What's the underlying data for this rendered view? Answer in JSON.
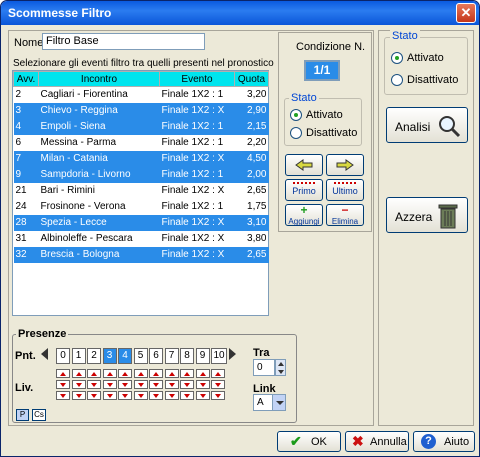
{
  "window": {
    "title": "Scommesse Filtro",
    "close_glyph": "✕"
  },
  "name_label": "Nome",
  "name_value": "Filtro Base",
  "instruction": "Selezionare gli eventi filtro tra quelli presenti nel pronostico",
  "table": {
    "headers": [
      "Avv.",
      "Incontro",
      "Evento",
      "Quota"
    ],
    "rows": [
      {
        "avv": "2",
        "incontro": "Cagliari - Fiorentina",
        "evento": "Finale 1X2 : 1",
        "quota": "3,20",
        "selected": false
      },
      {
        "avv": "3",
        "incontro": "Chievo - Reggina",
        "evento": "Finale 1X2 : X",
        "quota": "2,90",
        "selected": true
      },
      {
        "avv": "4",
        "incontro": "Empoli - Siena",
        "evento": "Finale 1X2 : 1",
        "quota": "2,15",
        "selected": true
      },
      {
        "avv": "6",
        "incontro": "Messina - Parma",
        "evento": "Finale 1X2 : 1",
        "quota": "2,20",
        "selected": false
      },
      {
        "avv": "7",
        "incontro": "Milan - Catania",
        "evento": "Finale 1X2 : X",
        "quota": "4,50",
        "selected": true
      },
      {
        "avv": "9",
        "incontro": "Sampdoria - Livorno",
        "evento": "Finale 1X2 : 1",
        "quota": "2,00",
        "selected": true
      },
      {
        "avv": "21",
        "incontro": "Bari - Rimini",
        "evento": "Finale 1X2 : X",
        "quota": "2,65",
        "selected": false
      },
      {
        "avv": "24",
        "incontro": "Frosinone - Verona",
        "evento": "Finale 1X2 : 1",
        "quota": "1,75",
        "selected": false
      },
      {
        "avv": "28",
        "incontro": "Spezia - Lecce",
        "evento": "Finale 1X2 : X",
        "quota": "3,10",
        "selected": true
      },
      {
        "avv": "31",
        "incontro": "Albinoleffe - Pescara",
        "evento": "Finale 1X2 : X",
        "quota": "3,80",
        "selected": false
      },
      {
        "avv": "32",
        "incontro": "Brescia - Bologna",
        "evento": "Finale 1X2 : X",
        "quota": "2,65",
        "selected": true
      }
    ]
  },
  "condizione": {
    "label": "Condizione N.",
    "value": "1/1"
  },
  "stato_inner": {
    "label": "Stato",
    "options": [
      "Attivato",
      "Disattivato"
    ],
    "selected": "Attivato"
  },
  "stato_outer": {
    "label": "Stato",
    "options": [
      "Attivato",
      "Disattivato"
    ],
    "selected": "Attivato"
  },
  "nav_buttons": {
    "primo": "Primo",
    "ultimo": "Ultimo",
    "aggiungi": "Aggiungi",
    "elimina": "Elimina"
  },
  "analisi_label": "Analisi",
  "azzera_label": "Azzera",
  "presenze": {
    "title": "Presenze",
    "pnt_label": "Pnt.",
    "numbers": [
      "0",
      "1",
      "2",
      "3",
      "4",
      "5",
      "6",
      "7",
      "8",
      "9",
      "10"
    ],
    "selected_numbers": [
      "3",
      "4"
    ],
    "liv_label": "Liv.",
    "tra_label": "Tra",
    "tra_value": "0",
    "link_label": "Link",
    "link_value": "A",
    "p_button": "P",
    "cs_button": "Cs"
  },
  "footer": {
    "ok": "OK",
    "annulla": "Annulla",
    "aiuto": "Aiuto"
  },
  "colors": {
    "selection": "#2a8ce8",
    "header": "#00e5ee",
    "title_bar": "#0a5ae0"
  }
}
